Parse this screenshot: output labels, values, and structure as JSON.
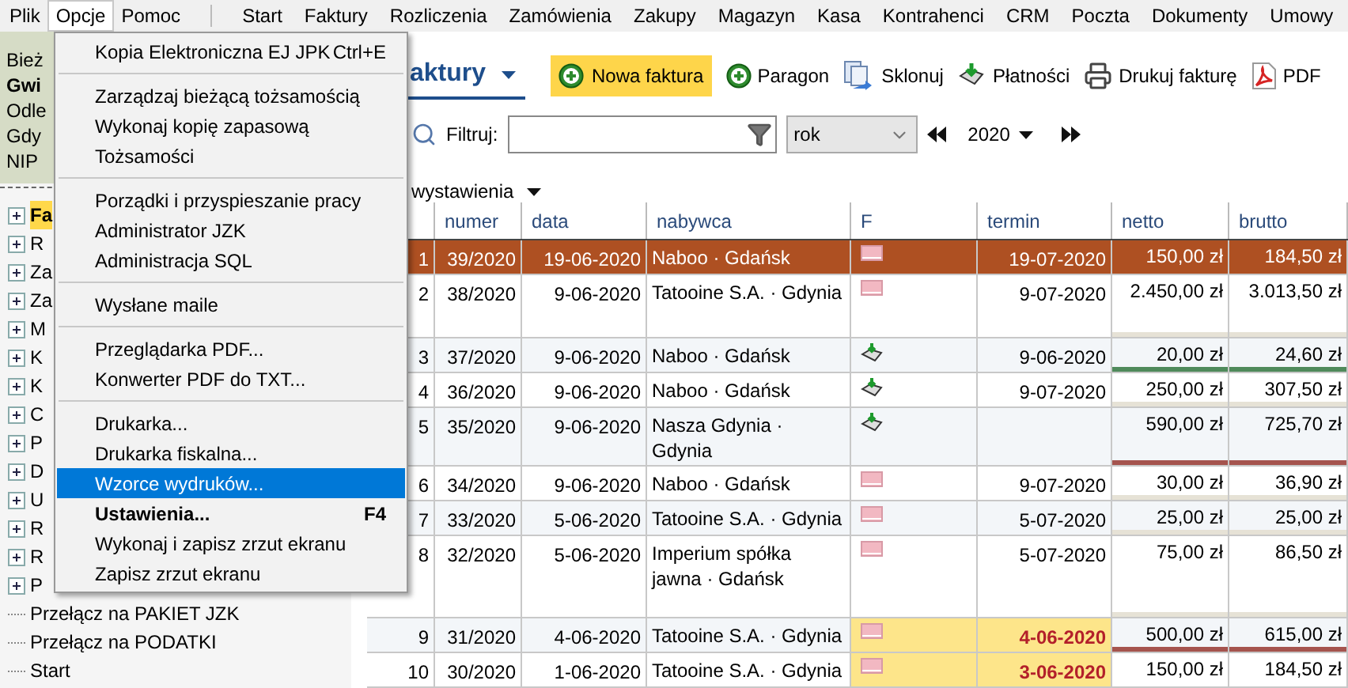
{
  "menubar": {
    "left": [
      {
        "label": "Plik",
        "selected": false
      },
      {
        "label": "Opcje",
        "selected": true
      },
      {
        "label": "Pomoc",
        "selected": false
      }
    ],
    "right": [
      {
        "label": "Start",
        "selected": false
      },
      {
        "label": "Faktury",
        "selected": false
      },
      {
        "label": "Rozliczenia",
        "selected": false
      },
      {
        "label": "Zamówienia",
        "selected": false
      },
      {
        "label": "Zakupy",
        "selected": false
      },
      {
        "label": "Magazyn",
        "selected": false
      },
      {
        "label": "Kasa",
        "selected": false
      },
      {
        "label": "Kontrahenci",
        "selected": false
      },
      {
        "label": "CRM",
        "selected": false
      },
      {
        "label": "Poczta",
        "selected": false
      },
      {
        "label": "Dokumenty",
        "selected": false
      },
      {
        "label": "Umowy",
        "selected": false
      }
    ]
  },
  "menu": {
    "groups": [
      [
        {
          "label": "Kopia Elektroniczna EJ JPK",
          "shortcut": "Ctrl+E",
          "selected": false,
          "bold": false
        }
      ],
      [
        {
          "label": "Zarządzaj bieżącą tożsamością",
          "selected": false,
          "bold": false
        },
        {
          "label": "Wykonaj kopię zapasową",
          "selected": false,
          "bold": false
        },
        {
          "label": "Tożsamości",
          "selected": false,
          "bold": false
        }
      ],
      [
        {
          "label": "Porządki i przyspieszanie pracy",
          "selected": false,
          "bold": false
        },
        {
          "label": "Administrator JZK",
          "selected": false,
          "bold": false
        },
        {
          "label": "Administracja SQL",
          "selected": false,
          "bold": false
        }
      ],
      [
        {
          "label": "Wysłane maile",
          "selected": false,
          "bold": false
        }
      ],
      [
        {
          "label": "Przeglądarka PDF...",
          "selected": false,
          "bold": false
        },
        {
          "label": "Konwerter PDF do TXT...",
          "selected": false,
          "bold": false
        }
      ],
      [
        {
          "label": "Drukarka...",
          "selected": false,
          "bold": false
        },
        {
          "label": "Drukarka fiskalna...",
          "selected": false,
          "bold": false
        },
        {
          "label": "Wzorce wydruków...",
          "selected": true,
          "bold": false
        },
        {
          "label": "Ustawienia...",
          "shortcut": "F4",
          "selected": false,
          "bold": true
        },
        {
          "label": "Wykonaj i zapisz zrzut ekranu",
          "selected": false,
          "bold": false
        },
        {
          "label": "Zapisz zrzut ekranu",
          "selected": false,
          "bold": false
        }
      ]
    ]
  },
  "sidebar": {
    "info": [
      {
        "text": "Bież",
        "bold": false
      },
      {
        "text": "Gwi",
        "bold": true
      },
      {
        "text": "Odle",
        "bold": false
      },
      {
        "text": "Gdy",
        "bold": false
      },
      {
        "text": "NIP",
        "bold": false
      }
    ],
    "tree": [
      {
        "label": "Fa",
        "expandable": true,
        "selected": true
      },
      {
        "label": "R",
        "expandable": true,
        "selected": false
      },
      {
        "label": "Za",
        "expandable": true,
        "selected": false
      },
      {
        "label": "Za",
        "expandable": true,
        "selected": false
      },
      {
        "label": "M",
        "expandable": true,
        "selected": false
      },
      {
        "label": "K",
        "expandable": true,
        "selected": false
      },
      {
        "label": "K",
        "expandable": true,
        "selected": false
      },
      {
        "label": "C",
        "expandable": true,
        "selected": false
      },
      {
        "label": "P",
        "expandable": true,
        "selected": false
      },
      {
        "label": "D",
        "expandable": true,
        "selected": false
      },
      {
        "label": "U",
        "expandable": true,
        "selected": false
      },
      {
        "label": "R",
        "expandable": true,
        "selected": false
      },
      {
        "label": "R",
        "expandable": true,
        "selected": false
      },
      {
        "label": "P",
        "expandable": true,
        "selected": false
      },
      {
        "label": "Przełącz na PAKIET JZK",
        "expandable": false,
        "selected": false
      },
      {
        "label": "Przełącz na PODATKI",
        "expandable": false,
        "selected": false
      },
      {
        "label": "Start",
        "expandable": false,
        "selected": false
      }
    ]
  },
  "toolbar": {
    "title": "aktury",
    "buttons": [
      {
        "label": "Nowa faktura",
        "kind": "add",
        "highlighted": true
      },
      {
        "label": "Paragon",
        "kind": "add",
        "highlighted": false
      },
      {
        "label": "Sklonuj",
        "kind": "clone",
        "highlighted": false
      },
      {
        "label": "Płatności",
        "kind": "payment",
        "highlighted": false
      },
      {
        "label": "Drukuj fakturę",
        "kind": "print",
        "highlighted": false
      },
      {
        "label": "PDF",
        "kind": "pdf",
        "highlighted": false
      }
    ]
  },
  "filter": {
    "label": "Filtruj:",
    "period": "rok",
    "year": "2020"
  },
  "sort": {
    "label": "wystawienia"
  },
  "table": {
    "columns": [
      "numer",
      "data",
      "nabywca",
      "F",
      "termin",
      "netto",
      "brutto"
    ],
    "rows": [
      {
        "lp": "1",
        "numer": "39/2020",
        "data": "19-06-2020",
        "nabywca": "Naboo · Gdańsk",
        "kind": "mail",
        "termin": "19-07-2020",
        "overdue": false,
        "netto": "150,00 zł",
        "brutto": "184,50 zł",
        "selected": true
      },
      {
        "lp": "2",
        "numer": "38/2020",
        "data": "9-06-2020",
        "nabywca": "Tatooine S.A. · Gdynia",
        "kind": "mail",
        "termin": "9-07-2020",
        "overdue": false,
        "netto": "2.450,00 zł",
        "brutto": "3.013,50 zł",
        "selected": false,
        "color": "#e6e2d6"
      },
      {
        "lp": "3",
        "numer": "37/2020",
        "data": "9-06-2020",
        "nabywca": "Naboo · Gdańsk",
        "kind": "paid",
        "termin": "9-06-2020",
        "overdue": false,
        "netto": "20,00 zł",
        "brutto": "24,60 zł",
        "selected": false,
        "color": "#4f8a5b"
      },
      {
        "lp": "4",
        "numer": "36/2020",
        "data": "9-06-2020",
        "nabywca": "Naboo · Gdańsk",
        "kind": "paid",
        "termin": "9-07-2020",
        "overdue": false,
        "netto": "250,00 zł",
        "brutto": "307,50 zł",
        "selected": false,
        "color": "#e6e2d6"
      },
      {
        "lp": "5",
        "numer": "35/2020",
        "data": "9-06-2020",
        "nabywca": "Nasza Gdynia · Gdynia",
        "kind": "paid",
        "termin": "",
        "overdue": false,
        "netto": "590,00 zł",
        "brutto": "725,70 zł",
        "selected": false,
        "color": "#a5544e"
      },
      {
        "lp": "6",
        "numer": "34/2020",
        "data": "9-06-2020",
        "nabywca": "Naboo · Gdańsk",
        "kind": "mail",
        "termin": "9-07-2020",
        "overdue": false,
        "netto": "30,00 zł",
        "brutto": "36,90 zł",
        "selected": false,
        "color": "#e6e2d6"
      },
      {
        "lp": "7",
        "numer": "33/2020",
        "data": "5-06-2020",
        "nabywca": "Tatooine S.A. · Gdynia",
        "kind": "mail",
        "termin": "5-07-2020",
        "overdue": false,
        "netto": "25,00 zł",
        "brutto": "25,00 zł",
        "selected": false,
        "color": "#e6e2d6"
      },
      {
        "lp": "8",
        "numer": "32/2020",
        "data": "5-06-2020",
        "nabywca": "Imperium spółka jawna · Gdańsk",
        "kind": "mail",
        "termin": "5-07-2020",
        "overdue": false,
        "netto": "75,00 zł",
        "brutto": "86,50 zł",
        "selected": false,
        "color": "#e6e2d6"
      },
      {
        "lp": "9",
        "numer": "31/2020",
        "data": "4-06-2020",
        "nabywca": "Tatooine S.A. · Gdynia",
        "kind": "mail",
        "termin": "4-06-2020",
        "overdue": true,
        "netto": "500,00 zł",
        "brutto": "615,00 zł",
        "selected": false,
        "color": "#a5544e"
      },
      {
        "lp": "10",
        "numer": "30/2020",
        "data": "1-06-2020",
        "nabywca": "Tatooine S.A. · Gdynia",
        "kind": "mail",
        "termin": "3-06-2020",
        "overdue": true,
        "netto": "150,00 zł",
        "brutto": "184,50 zł",
        "selected": false
      }
    ]
  }
}
